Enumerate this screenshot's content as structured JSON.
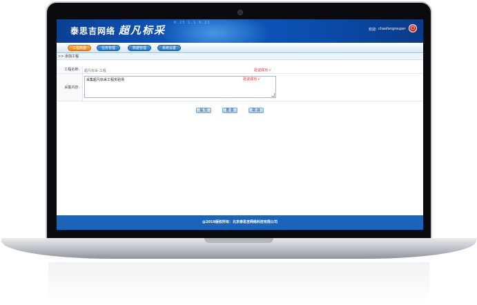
{
  "header": {
    "brand_cn": "泰思吉网络",
    "brand_script": "超凡标采",
    "digits": "0.23  1,1 0.23",
    "welcome": "欢迎:",
    "username": "chaofangrouper",
    "power_glyph": "⏻"
  },
  "nav": {
    "tabs": [
      {
        "label": "工程数据",
        "active": true
      },
      {
        "label": "任务管理",
        "active": false
      },
      {
        "label": "数据管理",
        "active": false
      },
      {
        "label": "系统设置",
        "active": false
      }
    ]
  },
  "breadcrumb": ">> 添加工程",
  "form": {
    "project_name_label": "工程名称:",
    "project_name_value": "超凡标采-工程",
    "project_name_valid": "验证成功 √",
    "content_label": "采集内容:",
    "content_value": "采集超凡标采工程实验场",
    "content_valid": "验证成功 √"
  },
  "buttons": {
    "submit": "提 交",
    "reset": "重 置",
    "cancel": "取 消"
  },
  "footer": "@2019版权所有：北京泰思吉网络科技有限公司",
  "colors": {
    "header_blue": "#0e5bc3",
    "active_tab": "#f07f13",
    "tab_blue": "#1d6fc0",
    "valid_red": "#e02020",
    "footer_blue": "#1c64b7"
  }
}
